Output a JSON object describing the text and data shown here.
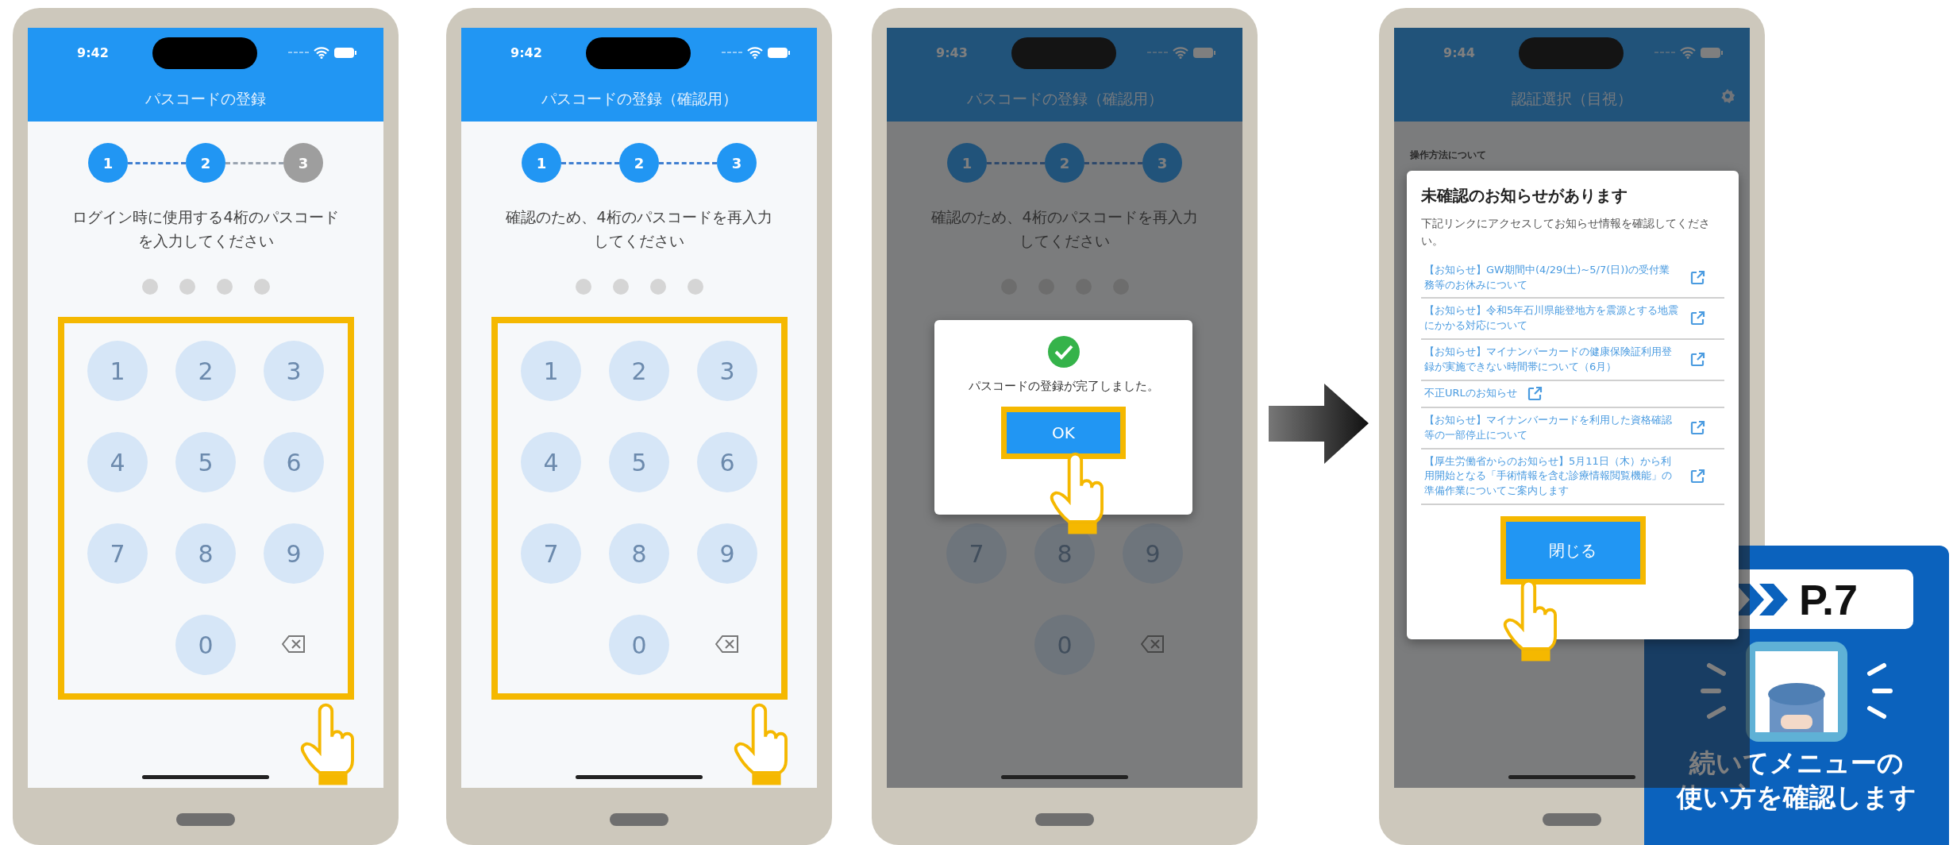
{
  "phones": [
    {
      "kind": "keypad",
      "time": "9:42",
      "title": "パスコードの登録",
      "steps": [
        {
          "label": "1",
          "done": true
        },
        {
          "label": "2",
          "done": true
        },
        {
          "label": "3",
          "done": false
        }
      ],
      "instruction": "ログイン時に使用する4桁のパスコードを入力してください",
      "pin_dots": [
        {
          "filled": false
        },
        {
          "filled": false
        },
        {
          "filled": false
        },
        {
          "filled": false
        }
      ],
      "highlighted": true,
      "keys": [
        {
          "kind": "digit",
          "label": "1"
        },
        {
          "kind": "digit",
          "label": "2"
        },
        {
          "kind": "digit",
          "label": "3"
        },
        {
          "kind": "digit",
          "label": "4"
        },
        {
          "kind": "digit",
          "label": "5"
        },
        {
          "kind": "digit",
          "label": "6"
        },
        {
          "kind": "digit",
          "label": "7"
        },
        {
          "kind": "digit",
          "label": "8"
        },
        {
          "kind": "digit",
          "label": "9"
        },
        {
          "kind": "blank"
        },
        {
          "kind": "digit",
          "label": "0"
        },
        {
          "kind": "delete"
        }
      ]
    },
    {
      "kind": "keypad",
      "time": "9:42",
      "title": "パスコードの登録（確認用）",
      "steps": [
        {
          "label": "1",
          "done": true
        },
        {
          "label": "2",
          "done": true
        },
        {
          "label": "3",
          "done": true
        }
      ],
      "instruction": "確認のため、4桁のパスコードを再入力してください",
      "pin_dots": [
        {
          "filled": false
        },
        {
          "filled": false
        },
        {
          "filled": false
        },
        {
          "filled": false
        }
      ],
      "highlighted": true,
      "keys": [
        {
          "kind": "digit",
          "label": "1"
        },
        {
          "kind": "digit",
          "label": "2"
        },
        {
          "kind": "digit",
          "label": "3"
        },
        {
          "kind": "digit",
          "label": "4"
        },
        {
          "kind": "digit",
          "label": "5"
        },
        {
          "kind": "digit",
          "label": "6"
        },
        {
          "kind": "digit",
          "label": "7"
        },
        {
          "kind": "digit",
          "label": "8"
        },
        {
          "kind": "digit",
          "label": "9"
        },
        {
          "kind": "blank"
        },
        {
          "kind": "digit",
          "label": "0"
        },
        {
          "kind": "delete"
        }
      ]
    },
    {
      "kind": "keypad",
      "time": "9:43",
      "title": "パスコードの登録（確認用）",
      "dimmed": true,
      "steps": [
        {
          "label": "1",
          "done": true
        },
        {
          "label": "2",
          "done": true
        },
        {
          "label": "3",
          "done": true
        }
      ],
      "instruction": "確認のため、4桁のパスコードを再入力してください",
      "pin_dots": [
        {
          "filled": false
        },
        {
          "filled": false
        },
        {
          "filled": false
        },
        {
          "filled": false
        }
      ],
      "keys": [
        {
          "kind": "covered"
        },
        {
          "kind": "covered"
        },
        {
          "kind": "covered"
        },
        {
          "kind": "covered"
        },
        {
          "kind": "covered"
        },
        {
          "kind": "covered"
        },
        {
          "kind": "digit",
          "label": "7"
        },
        {
          "kind": "digit",
          "label": "8"
        },
        {
          "kind": "digit",
          "label": "9"
        },
        {
          "kind": "blank"
        },
        {
          "kind": "digit",
          "label": "0"
        },
        {
          "kind": "delete"
        }
      ],
      "dialog": {
        "kind": "alert",
        "message": "パスコードの登録が完了しました。",
        "button": {
          "label": "OK",
          "highlighted": true
        }
      }
    },
    {
      "kind": "notice",
      "time": "9:44",
      "title": "認証選択（目視）",
      "settings": true,
      "dimmed": true,
      "section_label": "操作方法について",
      "dialog": {
        "kind": "notice",
        "title": "未確認のお知らせがあります",
        "description": "下記リンクにアクセスしてお知らせ情報を確認してください。",
        "links": [
          {
            "text": "【お知らせ】GW期間中(4/29(土)~5/7(日))の受付業務等のお休みについて"
          },
          {
            "text": "【お知らせ】令和5年石川県能登地方を震源とする地震にかかる対応について"
          },
          {
            "text": "【お知らせ】マイナンバーカードの健康保険証利用登録が実施できない時間帯について（6月）"
          },
          {
            "text": "不正URLのお知らせ"
          },
          {
            "text": "【お知らせ】マイナンバーカードを利用した資格確認等の一部停止について"
          },
          {
            "text": "【厚生労働省からのお知らせ】5月11日（木）から利用開始となる「手術情報を含む診療情報閲覧機能」の準備作業についてご案内します"
          }
        ],
        "button": {
          "label": "閉じる",
          "highlighted": true
        }
      }
    }
  ],
  "badge": {
    "page": "P.7",
    "caption_lines": [
      "続いてメニューの",
      "使い方を確認します"
    ]
  }
}
